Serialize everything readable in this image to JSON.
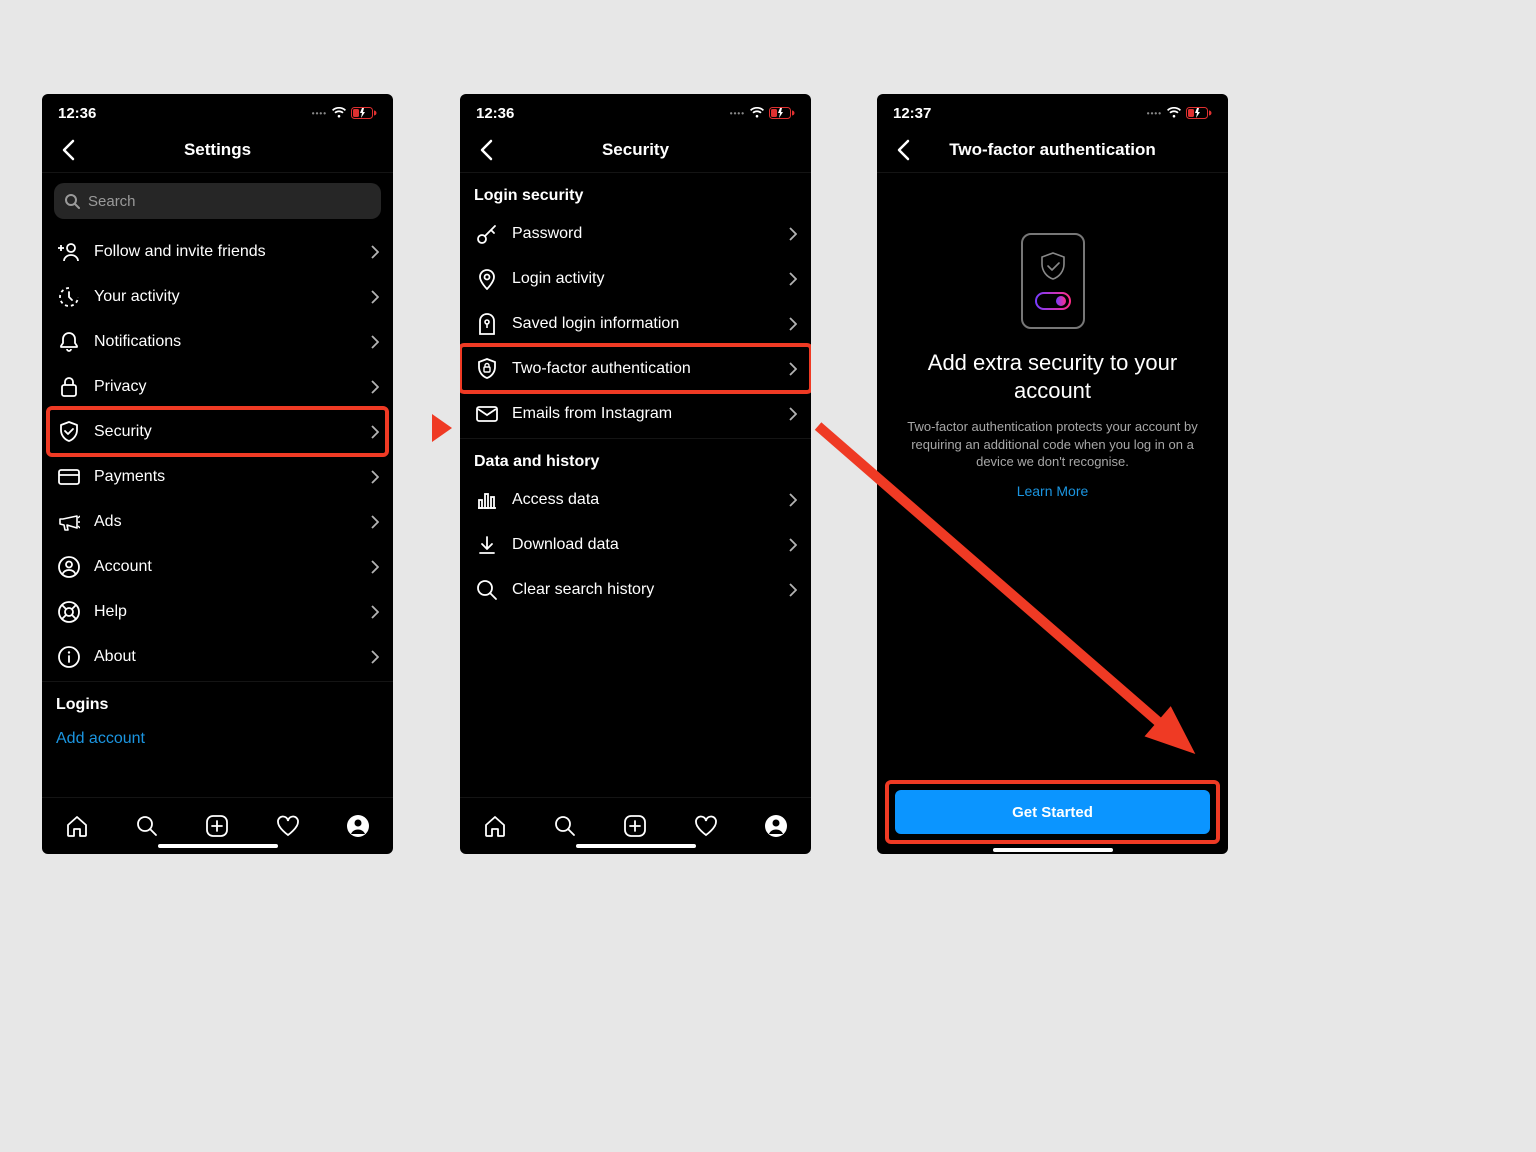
{
  "screens": {
    "s1": {
      "time": "12:36",
      "title": "Settings",
      "search_placeholder": "Search",
      "items": {
        "follow": "Follow and invite friends",
        "activity": "Your activity",
        "notifications": "Notifications",
        "privacy": "Privacy",
        "security": "Security",
        "payments": "Payments",
        "ads": "Ads",
        "account": "Account",
        "help": "Help",
        "about": "About"
      },
      "logins_header": "Logins",
      "add_account": "Add account"
    },
    "s2": {
      "time": "12:36",
      "title": "Security",
      "login_security_header": "Login security",
      "items": {
        "password": "Password",
        "login_activity": "Login activity",
        "saved_login": "Saved login information",
        "two_factor": "Two-factor authentication",
        "emails": "Emails from Instagram"
      },
      "data_history_header": "Data and history",
      "items2": {
        "access_data": "Access data",
        "download_data": "Download data",
        "clear_search": "Clear search history"
      }
    },
    "s3": {
      "time": "12:37",
      "title": "Two-factor authentication",
      "headline": "Add extra security to your account",
      "body": "Two-factor authentication protects your account by requiring an additional code when you log in on a device we don't recognise.",
      "learn_more": "Learn More",
      "cta": "Get Started"
    }
  }
}
